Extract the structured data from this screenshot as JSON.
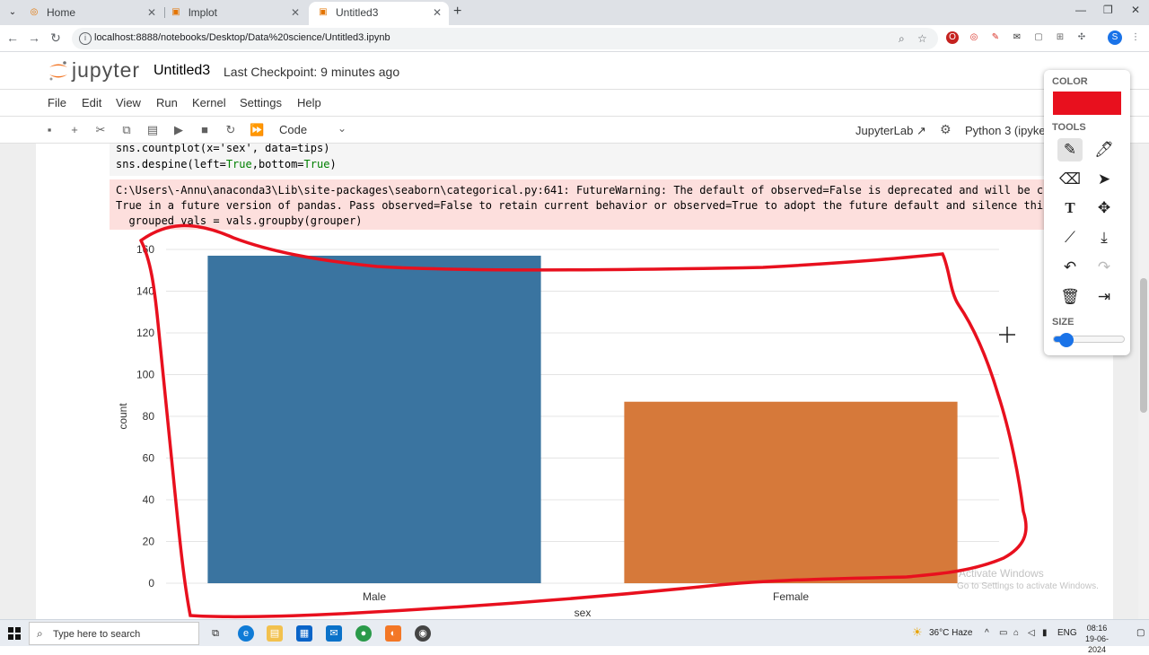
{
  "browser": {
    "tabs": [
      {
        "label": "Home",
        "active": false
      },
      {
        "label": "lmplot",
        "active": false
      },
      {
        "label": "Untitled3",
        "active": true
      }
    ],
    "url": "localhost:8888/notebooks/Desktop/Data%20science/Untitled3.ipynb"
  },
  "jupyter": {
    "logo_text": "jupyter",
    "notebook_title": "Untitled3",
    "checkpoint": "Last Checkpoint: 9 minutes ago",
    "menu": [
      "File",
      "Edit",
      "View",
      "Run",
      "Kernel",
      "Settings",
      "Help"
    ],
    "cell_type": "Code",
    "jupyterlab_link": "JupyterLab",
    "kernel": "Python 3 (ipyke"
  },
  "cell": {
    "code_line_1": "sns.countplot(x='sex', data=tips)",
    "code_line_2_prefix": "sns.despine(left=",
    "code_true_1": "True",
    "code_line_2_mid": ",bottom=",
    "code_true_2": "True",
    "code_line_2_suffix": ")",
    "warning_lines": [
      "C:\\Users\\-Annu\\anaconda3\\Lib\\site-packages\\seaborn\\categorical.py:641: FutureWarning: The default of observed=False is deprecated and will be cha",
      "True in a future version of pandas. Pass observed=False to retain current behavior or observed=True to adopt the future default and silence this",
      "  grouped_vals = vals.groupby(grouper)"
    ]
  },
  "chart_data": {
    "type": "bar",
    "categories": [
      "Male",
      "Female"
    ],
    "values": [
      157,
      87
    ],
    "colors": [
      "#3a74a0",
      "#d6793a"
    ],
    "xlabel": "sex",
    "ylabel": "count",
    "ylim": [
      0,
      160
    ],
    "yticks": [
      0,
      20,
      40,
      60,
      80,
      100,
      120,
      140,
      160
    ],
    "grid": true,
    "spines": "removed"
  },
  "draw_tools": {
    "color_label": "COLOR",
    "color": "#e8101e",
    "tools_label": "TOOLS",
    "size_label": "SIZE",
    "size_value": 0.15,
    "tools": [
      "pen-icon",
      "highlighter-icon",
      "eraser-icon",
      "pointer-icon",
      "text-icon",
      "move-icon",
      "line-icon",
      "download-icon",
      "undo-icon",
      "redo-icon",
      "trash-icon",
      "exit-icon"
    ]
  },
  "annotation": {
    "color": "#e8101e"
  },
  "watermark": {
    "line1": "Activate Windows",
    "line2": "Go to Settings to activate Windows."
  },
  "taskbar": {
    "search_placeholder": "Type here to search",
    "weather": "36°C  Haze",
    "language": "ENG",
    "time": "08:16",
    "date": "19-06-2024"
  }
}
